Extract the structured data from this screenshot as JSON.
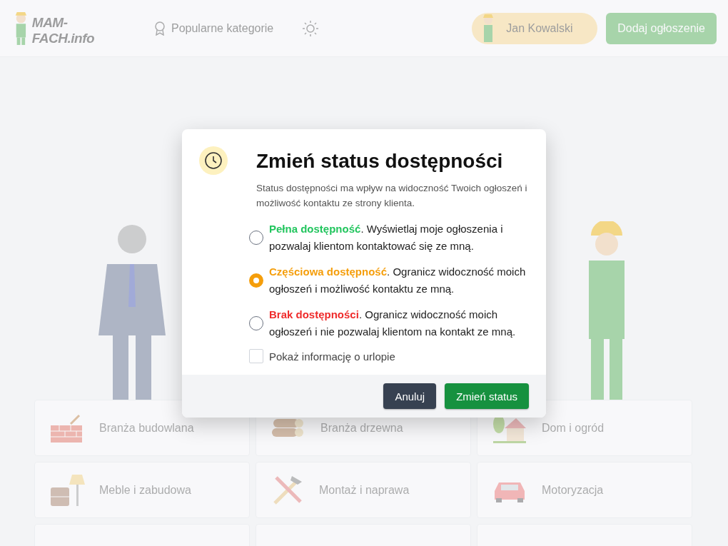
{
  "header": {
    "logo": "MAM-FACH.info",
    "nav_link": "Popularne kategorie",
    "user": {
      "name": "Jan Kowalski"
    },
    "add_button": "Dodaj ogłoszenie"
  },
  "categories": [
    {
      "label": "Branża budowlana",
      "kind": "bricks"
    },
    {
      "label": "Branża drzewna",
      "kind": "logs"
    },
    {
      "label": "Dom i ogród",
      "kind": "house"
    },
    {
      "label": "Meble i zabudowa",
      "kind": "furniture"
    },
    {
      "label": "Montaż i naprawa",
      "kind": "tools"
    },
    {
      "label": "Motoryzacja",
      "kind": "car"
    }
  ],
  "dialog": {
    "title": "Zmień status dostępności",
    "description": "Status dostępności ma wpływ na widoczność Twoich ogłoszeń i możliwość kontaktu ze strony klienta.",
    "options": [
      {
        "label": "Pełna dostępność",
        "text": ". Wyświetlaj moje ogłoszenia i pozwalaj klientom kontaktować się ze mną.",
        "color": "#22c55e",
        "selected": false
      },
      {
        "label": "Częściowa dostępność",
        "text": ". Ogranicz widoczność moich ogłoszeń i możliwość kontaktu ze mną.",
        "color": "#f59e0b",
        "selected": true
      },
      {
        "label": "Brak dostępności",
        "text": ". Ogranicz widoczność moich ogłoszeń i nie pozwalaj klientom na kontakt ze mną.",
        "color": "#ef2b2b",
        "selected": false
      }
    ],
    "vacation_checkbox": {
      "label": "Pokaż informację o urlopie",
      "checked": false
    },
    "buttons": [
      {
        "label": "Anuluj",
        "kind": "secondary"
      },
      {
        "label": "Zmień status",
        "kind": "primary"
      }
    ]
  }
}
